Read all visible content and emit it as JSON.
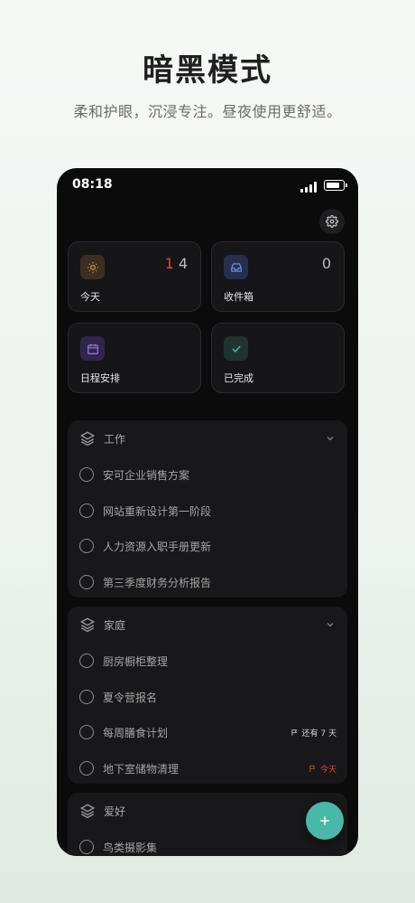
{
  "marketing": {
    "headline": "暗黑模式",
    "subhead": "柔和护眼，沉浸专注。昼夜使用更舒适。"
  },
  "status_bar": {
    "time": "08:18"
  },
  "smart_lists": [
    {
      "name": "today",
      "label": "今天",
      "icon": "sun-icon",
      "color": "#e7a13b",
      "overdue_count": "1",
      "count": "4"
    },
    {
      "name": "inbox",
      "label": "收件箱",
      "icon": "inbox-icon",
      "color": "#5b7fd6",
      "count": "0"
    },
    {
      "name": "scheduled",
      "label": "日程安排",
      "icon": "calendar-icon",
      "color": "#8e6ad6"
    },
    {
      "name": "completed",
      "label": "已完成",
      "icon": "check-icon",
      "color": "#4ab8a8"
    }
  ],
  "groups": [
    {
      "title": "工作",
      "tasks": [
        {
          "title": "安可企业销售方案"
        },
        {
          "title": "网站重新设计第一阶段"
        },
        {
          "title": "人力资源入职手册更新"
        },
        {
          "title": "第三季度财务分析报告"
        }
      ]
    },
    {
      "title": "家庭",
      "tasks": [
        {
          "title": "厨房橱柜整理"
        },
        {
          "title": "夏令营报名"
        },
        {
          "title": "每周膳食计划",
          "due": "还有 7 天"
        },
        {
          "title": "地下室储物清理",
          "due": "今天"
        }
      ]
    },
    {
      "title": "爱好",
      "tasks": [
        {
          "title": "鸟类摄影集"
        }
      ]
    }
  ],
  "colors": {
    "accent": "#4ab8a8",
    "overdue": "#e0473a",
    "background": "#0b0b0c"
  },
  "fab": {
    "icon": "plus-icon"
  }
}
